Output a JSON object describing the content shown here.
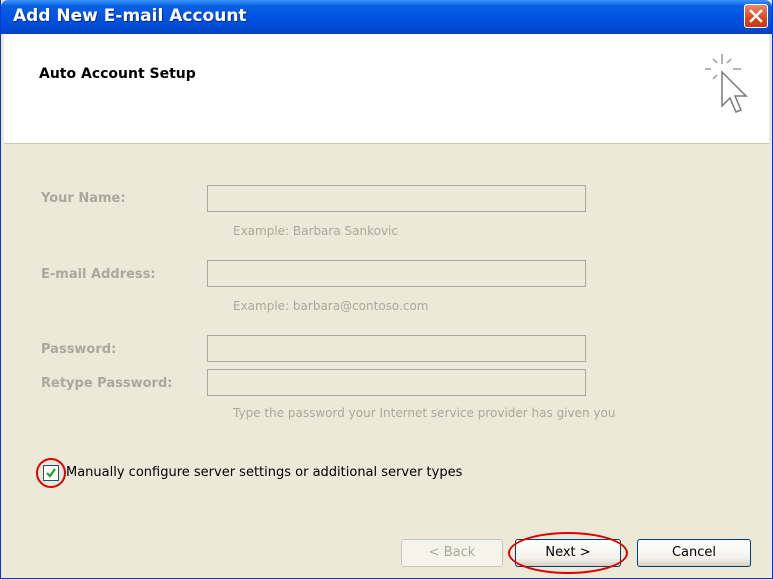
{
  "window": {
    "title": "Add New E-mail Account"
  },
  "header": {
    "title": "Auto Account Setup"
  },
  "form": {
    "name_label": "Your Name:",
    "name_value": "",
    "name_example": "Example: Barbara Sankovic",
    "email_label": "E-mail Address:",
    "email_value": "",
    "email_example": "Example: barbara@contoso.com",
    "password_label": "Password:",
    "password_value": "",
    "retype_label": "Retype Password:",
    "retype_value": "",
    "password_hint": "Type the password your Internet service provider has given you"
  },
  "manual_config": {
    "label": "Manually configure server settings or additional server types",
    "checked": true
  },
  "buttons": {
    "back": "< Back",
    "next": "Next >",
    "cancel": "Cancel"
  },
  "colors": {
    "titlebar": "#0054e3",
    "disabled_text": "#aca899",
    "highlight": "#e00000"
  },
  "icons": {
    "close": "close-icon",
    "wizard": "wizard-cursor-icon",
    "checkmark": "checkmark-icon"
  }
}
